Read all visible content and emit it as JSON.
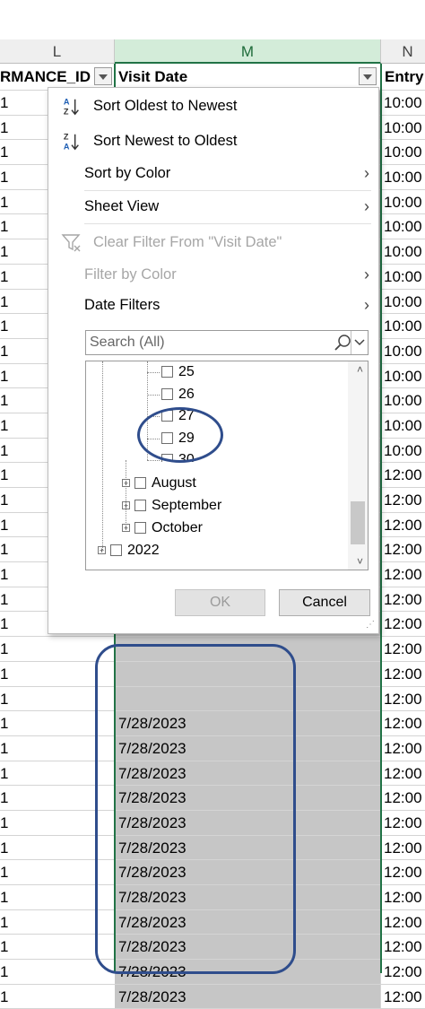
{
  "columns": {
    "L": "L",
    "M": "M",
    "N": "N"
  },
  "header": {
    "col_l_text": "RMANCE_ID",
    "col_m_text": "Visit Date",
    "col_n_text": "Entry"
  },
  "rows": [
    {
      "l": "1",
      "m": "",
      "n": "10:00"
    },
    {
      "l": "1",
      "m": "",
      "n": "10:00"
    },
    {
      "l": "1",
      "m": "",
      "n": "10:00"
    },
    {
      "l": "1",
      "m": "",
      "n": "10:00"
    },
    {
      "l": "1",
      "m": "",
      "n": "10:00"
    },
    {
      "l": "1",
      "m": "",
      "n": "10:00"
    },
    {
      "l": "1",
      "m": "",
      "n": "10:00"
    },
    {
      "l": "1",
      "m": "",
      "n": "10:00"
    },
    {
      "l": "1",
      "m": "",
      "n": "10:00"
    },
    {
      "l": "1",
      "m": "",
      "n": "10:00"
    },
    {
      "l": "1",
      "m": "",
      "n": "10:00"
    },
    {
      "l": "1",
      "m": "",
      "n": "10:00"
    },
    {
      "l": "1",
      "m": "",
      "n": "10:00"
    },
    {
      "l": "1",
      "m": "",
      "n": "10:00"
    },
    {
      "l": "1",
      "m": "",
      "n": "10:00"
    },
    {
      "l": "1",
      "m": "",
      "n": "12:00"
    },
    {
      "l": "1",
      "m": "",
      "n": "12:00"
    },
    {
      "l": "1",
      "m": "",
      "n": "12:00"
    },
    {
      "l": "1",
      "m": "",
      "n": "12:00"
    },
    {
      "l": "1",
      "m": "",
      "n": "12:00"
    },
    {
      "l": "1",
      "m": "",
      "n": "12:00"
    },
    {
      "l": "1",
      "m": "",
      "n": "12:00"
    },
    {
      "l": "1",
      "m": "",
      "n": "12:00"
    },
    {
      "l": "1",
      "m": "",
      "n": "12:00"
    },
    {
      "l": "1",
      "m": "",
      "n": "12:00"
    },
    {
      "l": "1",
      "m": "7/28/2023",
      "n": "12:00"
    },
    {
      "l": "1",
      "m": "7/28/2023",
      "n": "12:00"
    },
    {
      "l": "1",
      "m": "7/28/2023",
      "n": "12:00"
    },
    {
      "l": "1",
      "m": "7/28/2023",
      "n": "12:00"
    },
    {
      "l": "1",
      "m": "7/28/2023",
      "n": "12:00"
    },
    {
      "l": "1",
      "m": "7/28/2023",
      "n": "12:00"
    },
    {
      "l": "1",
      "m": "7/28/2023",
      "n": "12:00"
    },
    {
      "l": "1",
      "m": "7/28/2023",
      "n": "12:00"
    },
    {
      "l": "1",
      "m": "7/28/2023",
      "n": "12:00"
    },
    {
      "l": "1",
      "m": "7/28/2023",
      "n": "12:00"
    },
    {
      "l": "1",
      "m": "7/28/2023",
      "n": "12:00"
    },
    {
      "l": "1",
      "m": "7/28/2023",
      "n": "12:00"
    }
  ],
  "menu": {
    "sort_oldest": "Sort Oldest to Newest",
    "sort_newest": "Sort Newest to Oldest",
    "sort_by_color": "Sort by Color",
    "sheet_view": "Sheet View",
    "clear_filter": "Clear Filter From \"Visit Date\"",
    "filter_by_color": "Filter by Color",
    "date_filters": "Date Filters",
    "search_placeholder": "Search (All)",
    "tree": {
      "d25": "25",
      "d26": "26",
      "d27": "27",
      "d29": "29",
      "d30": "30",
      "august": "August",
      "september": "September",
      "october": "October",
      "y2022": "2022"
    },
    "ok": "OK",
    "cancel": "Cancel"
  },
  "colors": {
    "selection_green": "#217346",
    "annotation_blue": "#2f4d8c",
    "selected_cell_gray": "#c6c6c6"
  },
  "icons": [
    "sort-ascending-icon",
    "sort-descending-icon",
    "clear-filter-icon",
    "search-icon",
    "chevron-right-icon",
    "filter-dropdown-icon"
  ]
}
